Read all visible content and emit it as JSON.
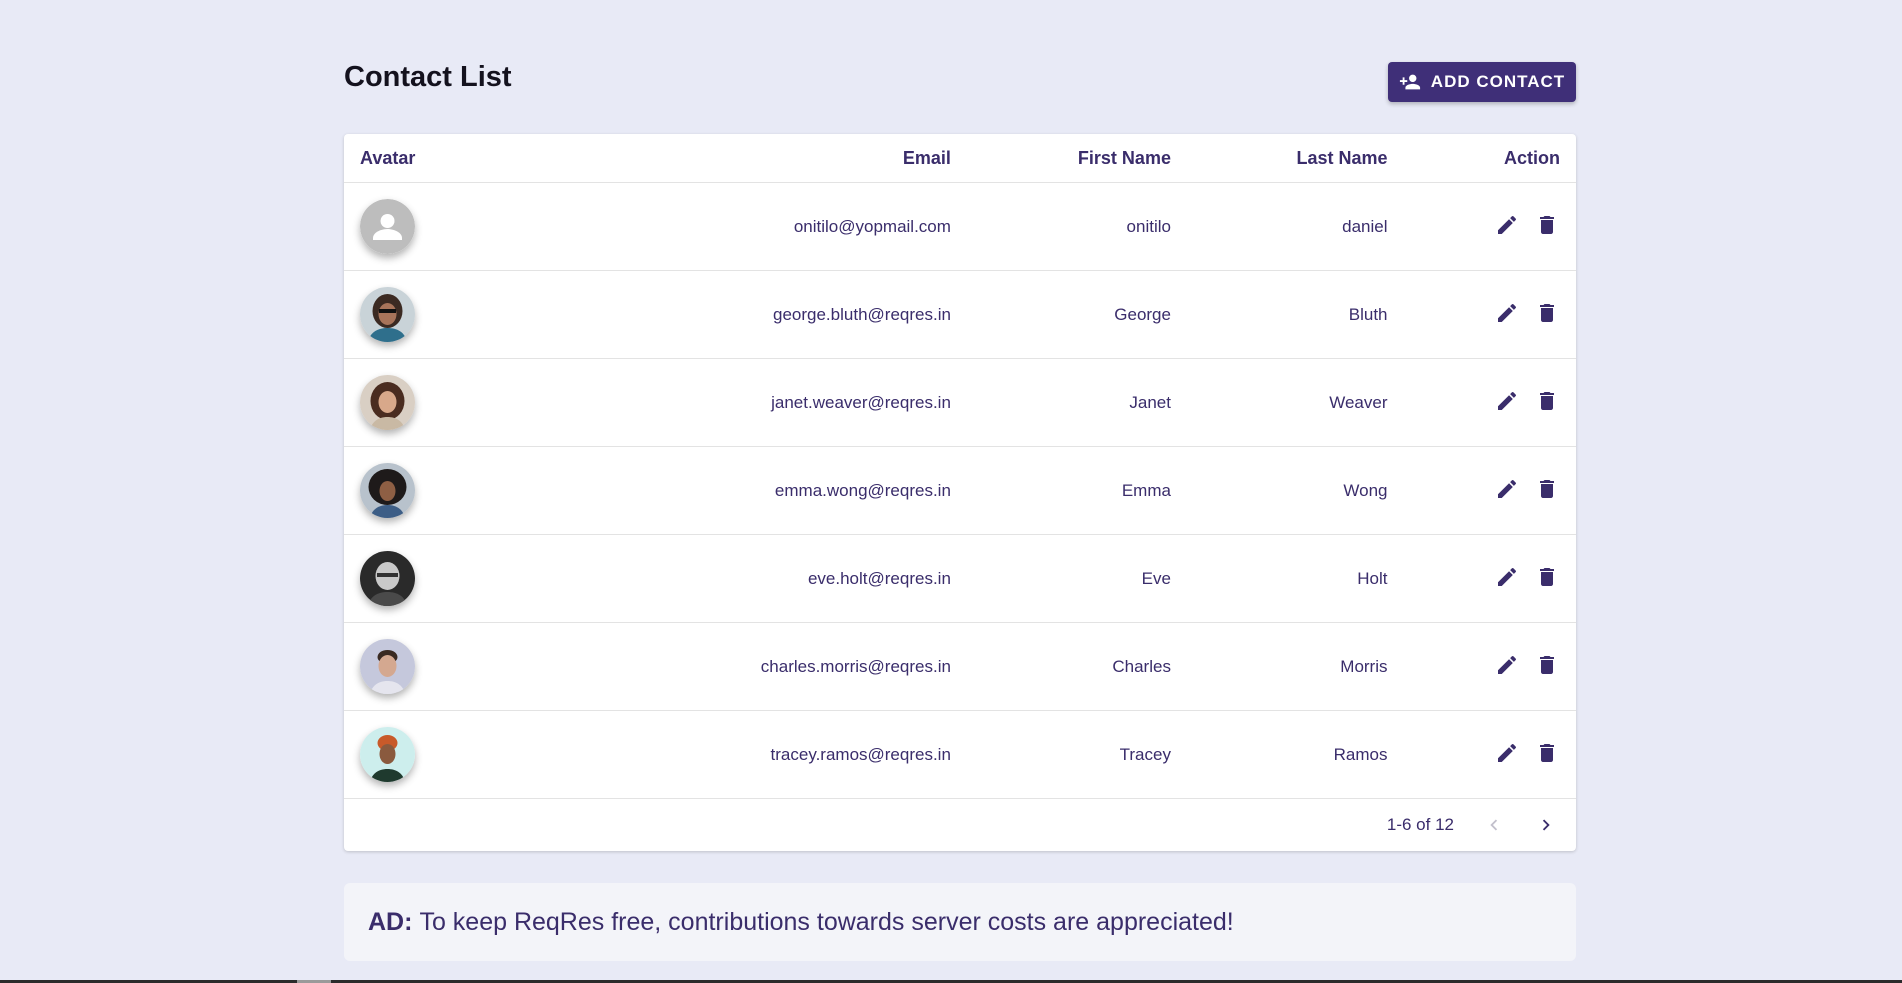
{
  "page": {
    "title": "Contact List"
  },
  "toolbar": {
    "add_label": "ADD CONTACT",
    "add_icon": "person-add-icon"
  },
  "table": {
    "columns": [
      "Avatar",
      "Email",
      "First Name",
      "Last Name",
      "Action"
    ],
    "rows": [
      {
        "email": "onitilo@yopmail.com",
        "first": "onitilo",
        "last": "daniel",
        "avatar": "default-avatar"
      },
      {
        "email": "george.bluth@reqres.in",
        "first": "George",
        "last": "Bluth",
        "avatar": "photo"
      },
      {
        "email": "janet.weaver@reqres.in",
        "first": "Janet",
        "last": "Weaver",
        "avatar": "photo"
      },
      {
        "email": "emma.wong@reqres.in",
        "first": "Emma",
        "last": "Wong",
        "avatar": "photo"
      },
      {
        "email": "eve.holt@reqres.in",
        "first": "Eve",
        "last": "Holt",
        "avatar": "photo"
      },
      {
        "email": "charles.morris@reqres.in",
        "first": "Charles",
        "last": "Morris",
        "avatar": "photo"
      },
      {
        "email": "tracey.ramos@reqres.in",
        "first": "Tracey",
        "last": "Ramos",
        "avatar": "photo"
      }
    ]
  },
  "pagination": {
    "range": "1-6 of 12"
  },
  "ad": {
    "label": "AD:",
    "text": "To keep ReqRes free, contributions towards server costs are appreciated!"
  },
  "colors": {
    "accent": "#3f2f78",
    "text": "#3a2d6b",
    "background": "#e8eaf6"
  }
}
